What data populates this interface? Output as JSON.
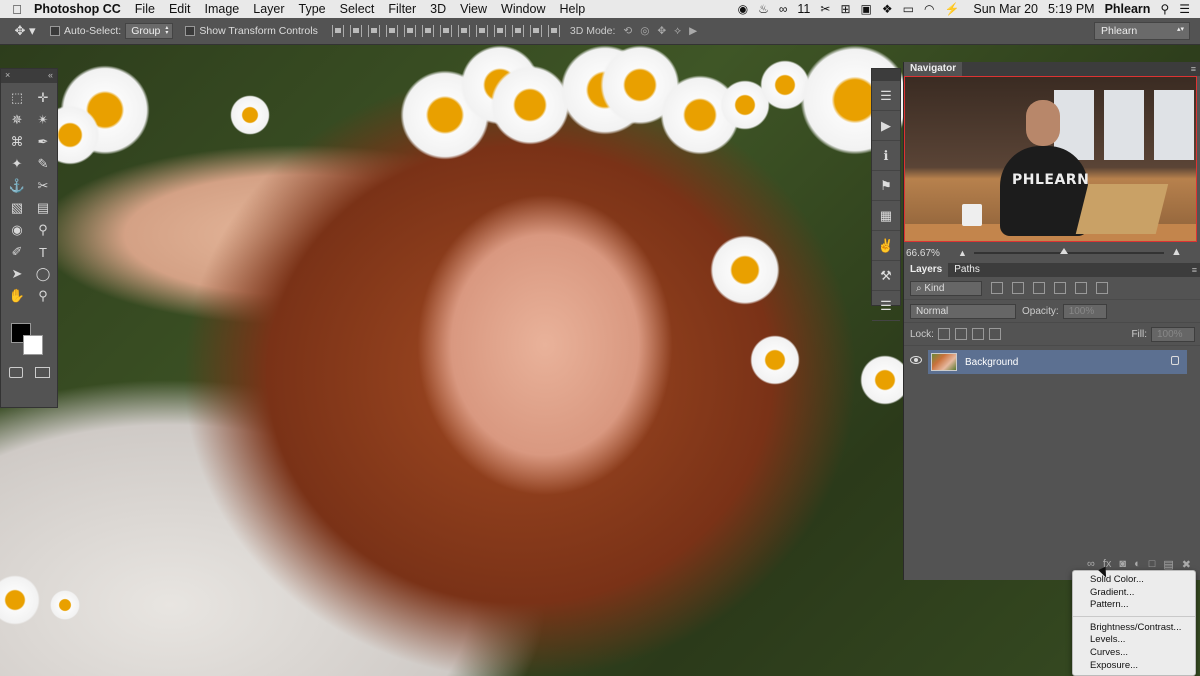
{
  "menubar": {
    "apple": "",
    "app_name": "Photoshop CC",
    "items": [
      "File",
      "Edit",
      "Image",
      "Layer",
      "Type",
      "Select",
      "Filter",
      "3D",
      "View",
      "Window",
      "Help"
    ],
    "status": {
      "notif_count": "11",
      "battery": "⚡",
      "date": "Sun Mar 20",
      "time": "5:19 PM",
      "user": "Phlearn"
    }
  },
  "optionsbar": {
    "tool_icon": "move-tool-icon",
    "auto_select_label": "Auto-Select:",
    "auto_select_value": "Group",
    "show_transform_label": "Show Transform Controls",
    "mode_label": "3D Mode:",
    "workspace": "Phlearn"
  },
  "tools": {
    "icons": [
      "⬚",
      "✛",
      "✵",
      "✴",
      "⌘",
      "✒",
      "✦",
      "✎",
      "⚓",
      "✂",
      "▧",
      "▤",
      "◉",
      "⚲",
      "✐",
      "T",
      "➤",
      "◯",
      "✋",
      "⚲"
    ]
  },
  "dock": {
    "icons": [
      "☰",
      "▶",
      "ℹ",
      "⚑",
      "▦",
      "✌",
      "⚒",
      "☰"
    ]
  },
  "navigator": {
    "tab": "Navigator",
    "shirt_text": "PHLEARN",
    "zoom": "66.67%"
  },
  "layers_panel": {
    "tab_layers": "Layers",
    "tab_paths": "Paths",
    "filter_kind": "⌕ Kind",
    "blend_mode": "Normal",
    "opacity_label": "Opacity:",
    "opacity_value": "100%",
    "lock_label": "Lock:",
    "fill_label": "Fill:",
    "fill_value": "100%",
    "layer_name": "Background",
    "footer_icons": [
      "∞",
      "fx",
      "◙",
      "◐",
      "□",
      "▤",
      "✖"
    ]
  },
  "context_menu": {
    "items": [
      "Solid Color...",
      "Gradient...",
      "Pattern..."
    ],
    "items2": [
      "Brightness/Contrast...",
      "Levels...",
      "Curves...",
      "Exposure..."
    ]
  }
}
